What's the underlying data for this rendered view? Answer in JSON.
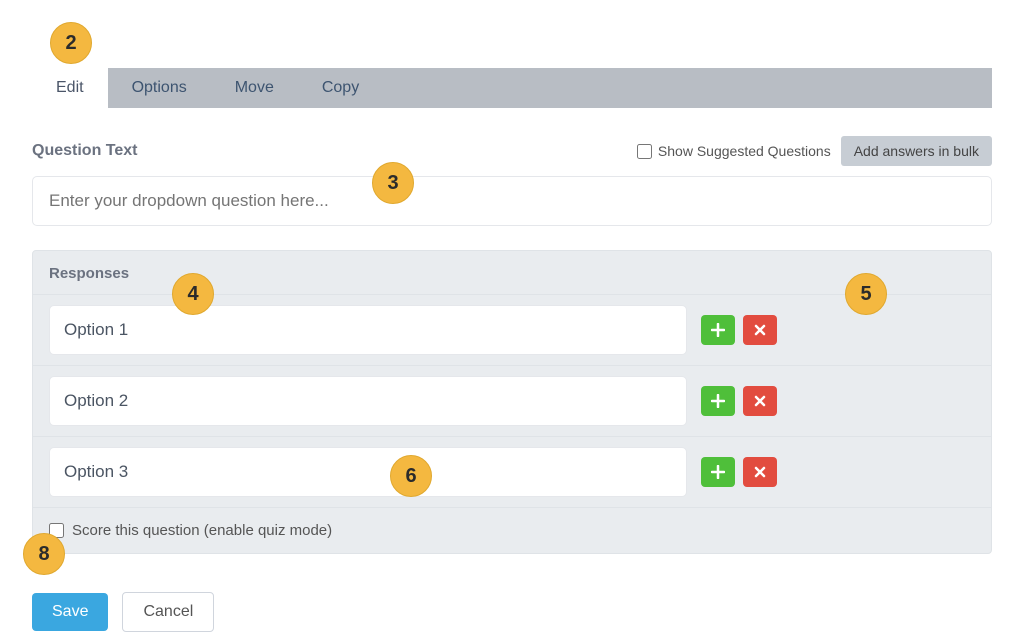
{
  "tabs": {
    "edit": "Edit",
    "options": "Options",
    "move": "Move",
    "copy": "Copy"
  },
  "question": {
    "label": "Question Text",
    "placeholder": "Enter your dropdown question here...",
    "suggested_label": "Show Suggested Questions",
    "bulk_button": "Add answers in bulk"
  },
  "responses": {
    "label": "Responses",
    "options": [
      "Option 1",
      "Option 2",
      "Option 3"
    ],
    "score_label": "Score this question (enable quiz mode)"
  },
  "footer": {
    "save": "Save",
    "cancel": "Cancel"
  },
  "annotations": {
    "b2": "2",
    "b3": "3",
    "b4": "4",
    "b5": "5",
    "b6": "6",
    "b8": "8"
  }
}
